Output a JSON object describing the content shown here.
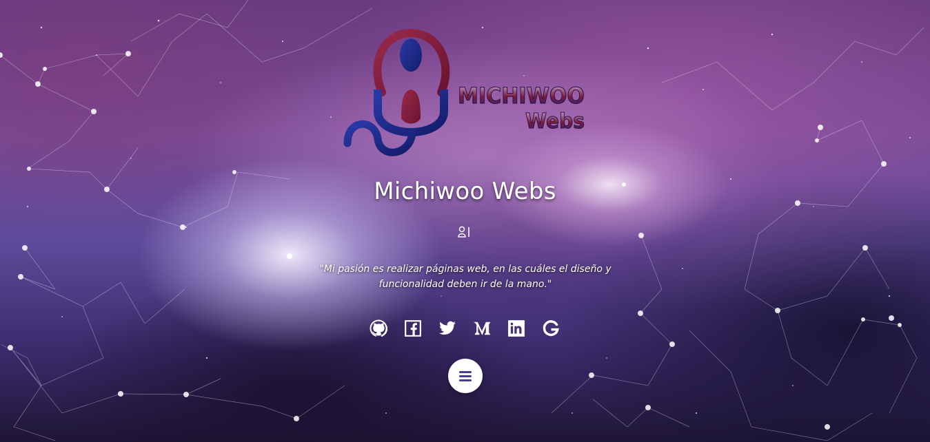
{
  "brand": {
    "logo_text_line1": "MICHIWOO",
    "logo_text_line2": "Webs",
    "title": "Michiwoo Webs"
  },
  "quote": "\"Mi pasión es realizar páginas web, en las cuáles el diseño y funcionalidad deben ir de la mano.\"",
  "social": [
    {
      "name": "github",
      "icon": "github-icon"
    },
    {
      "name": "facebook",
      "icon": "facebook-icon"
    },
    {
      "name": "twitter",
      "icon": "twitter-icon"
    },
    {
      "name": "medium",
      "icon": "medium-icon"
    },
    {
      "name": "linkedin",
      "icon": "linkedin-icon"
    },
    {
      "name": "google",
      "icon": "google-icon"
    }
  ],
  "menu": {
    "icon": "bars-icon"
  },
  "colors": {
    "logo_red": "#7a1a3a",
    "logo_blue": "#1e2a8a",
    "text": "#ffffff",
    "menu_icon": "#4a3d8f"
  }
}
